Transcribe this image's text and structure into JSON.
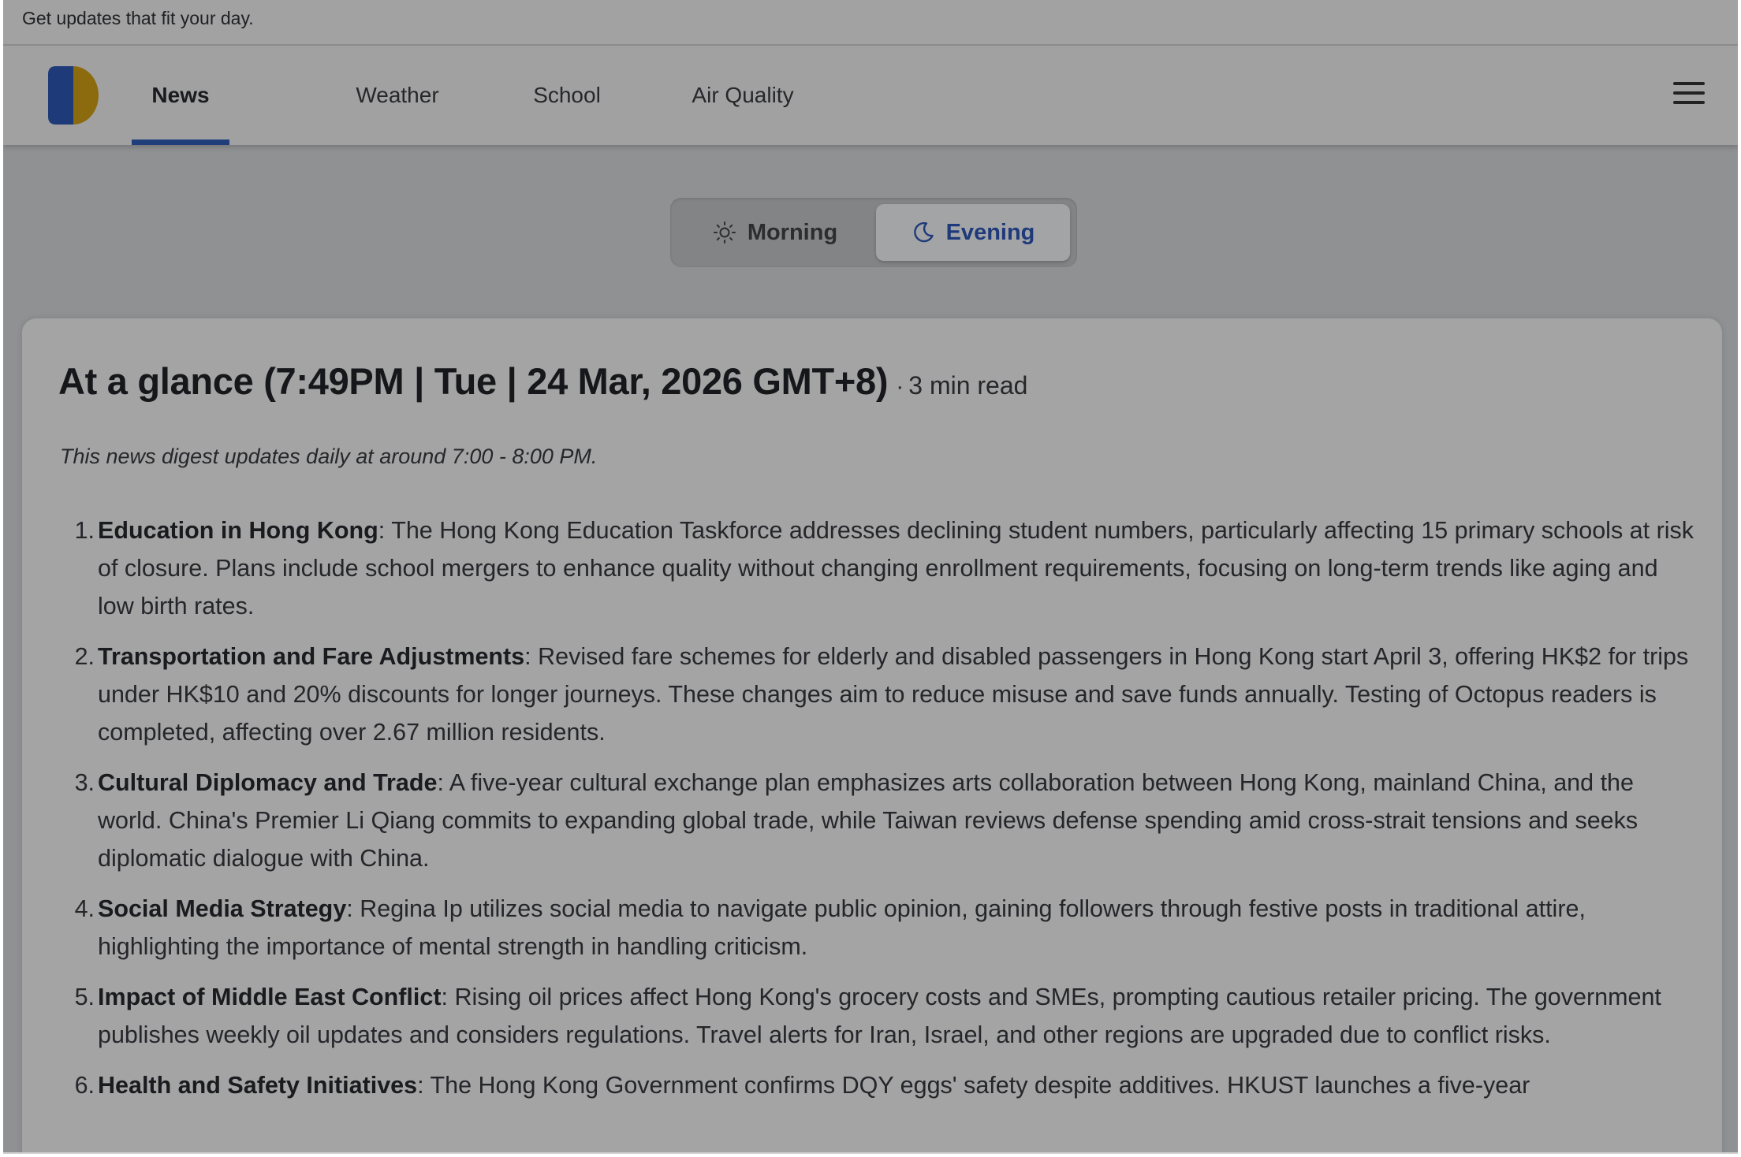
{
  "banner": {
    "text": "Get updates that fit your day."
  },
  "nav": {
    "tabs": [
      {
        "label": "News",
        "active": true
      },
      {
        "label": "Weather",
        "active": false
      },
      {
        "label": "School",
        "active": false
      },
      {
        "label": "Air Quality",
        "active": false
      }
    ]
  },
  "toggle": {
    "morning_label": "Morning",
    "evening_label": "Evening",
    "selected": "Evening"
  },
  "digest": {
    "title": "At a glance (7:49PM | Tue | 24 Mar, 2026 GMT+8)",
    "separator": "·",
    "read_time": "3 min read",
    "subtitle": "This news digest updates daily at around 7:00 - 8:00 PM.",
    "items": [
      {
        "num": "1.",
        "title": "Education in Hong Kong",
        "body": ": The Hong Kong Education Taskforce addresses declining student numbers, particularly affecting 15 primary schools at risk of closure. Plans include school mergers to enhance quality without changing enrollment requirements, focusing on long-term trends like aging and low birth rates."
      },
      {
        "num": "2.",
        "title": "Transportation and Fare Adjustments",
        "body": ": Revised fare schemes for elderly and disabled passengers in Hong Kong start April 3, offering HK$2 for trips under HK$10 and 20% discounts for longer journeys. These changes aim to reduce misuse and save funds annually. Testing of Octopus readers is completed, affecting over 2.67 million residents."
      },
      {
        "num": "3.",
        "title": "Cultural Diplomacy and Trade",
        "body": ": A five-year cultural exchange plan emphasizes arts collaboration between Hong Kong, mainland China, and the world. China's Premier Li Qiang commits to expanding global trade, while Taiwan reviews defense spending amid cross-strait tensions and seeks diplomatic dialogue with China."
      },
      {
        "num": "4.",
        "title": "Social Media Strategy",
        "body": ": Regina Ip utilizes social media to navigate public opinion, gaining followers through festive posts in traditional attire, highlighting the importance of mental strength in handling criticism."
      },
      {
        "num": "5.",
        "title": "Impact of Middle East Conflict",
        "body": ": Rising oil prices affect Hong Kong's grocery costs and SMEs, prompting cautious retailer pricing. The government publishes weekly oil updates and considers regulations. Travel alerts for Iran, Israel, and other regions are upgraded due to conflict risks."
      },
      {
        "num": "6.",
        "title": "Health and Safety Initiatives",
        "body": ": The Hong Kong Government confirms DQY eggs' safety despite additives. HKUST launches a five-year"
      }
    ]
  },
  "colors": {
    "accent": "#203f7a",
    "logo_blue": "#1e3a78",
    "logo_gold": "#8c6a0e"
  },
  "icons": {
    "morning": "sun-icon",
    "evening": "moon-icon",
    "menu": "hamburger-menu-icon"
  }
}
